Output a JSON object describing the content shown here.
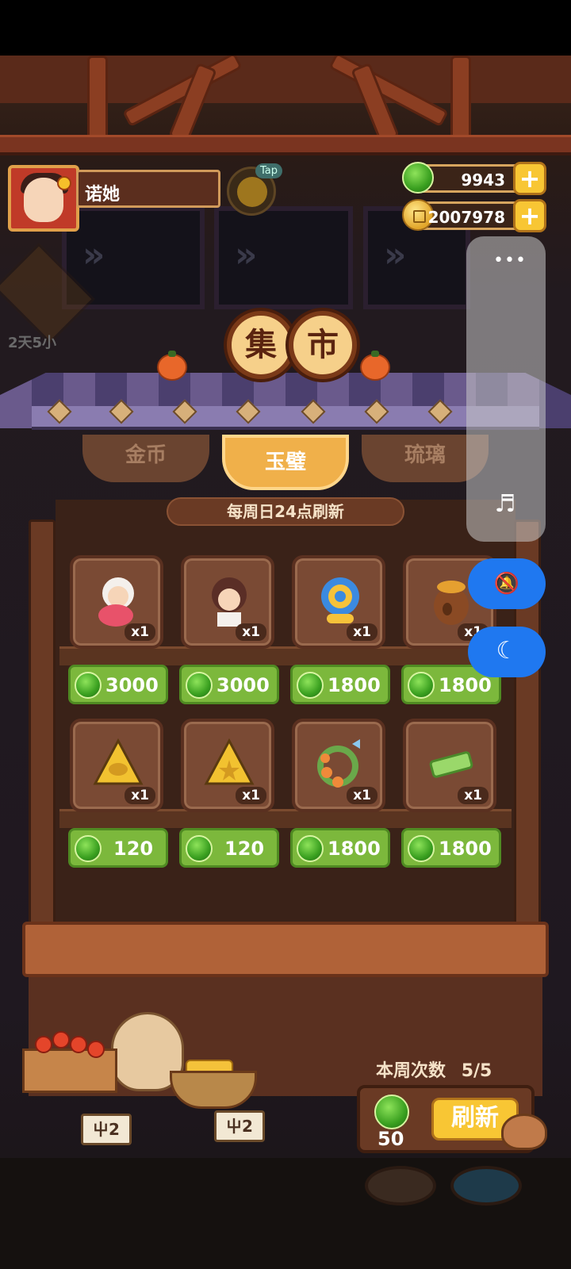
{
  "player": {
    "name": "诺她"
  },
  "tap_label": "Tap",
  "resources": {
    "jade": {
      "value": "9943",
      "icon": "jade-icon"
    },
    "coins": {
      "value": "2007978",
      "icon": "coin-icon"
    }
  },
  "event": {
    "countdown": "2天5小"
  },
  "sign_chars": [
    "集",
    "市"
  ],
  "tabs": [
    {
      "label": "金币",
      "active": false
    },
    {
      "label": "玉璧",
      "active": true
    },
    {
      "label": "琉璃",
      "active": false
    }
  ],
  "refresh_note": "每周日24点刷新",
  "items": [
    {
      "name": "chef-character-card",
      "qty": "x1",
      "price": "3000"
    },
    {
      "name": "maid-character-card",
      "qty": "x1",
      "price": "3000"
    },
    {
      "name": "blue-swirl-shell",
      "qty": "x1",
      "price": "1800"
    },
    {
      "name": "honey-pot",
      "qty": "x1",
      "price": "1800"
    },
    {
      "name": "fish-rice-ball",
      "qty": "x1",
      "price": "120"
    },
    {
      "name": "star-rice-ball",
      "qty": "x1",
      "price": "120"
    },
    {
      "name": "flower-butterfly-wreath",
      "qty": "x1",
      "price": "1800"
    },
    {
      "name": "green-jade-scroll",
      "qty": "x1",
      "price": "1800"
    }
  ],
  "weekly": {
    "label": "本周次数",
    "count": "5/5"
  },
  "refresh": {
    "cost": "50",
    "button_label": "刷新"
  },
  "tags": [
    "屮2",
    "屮2"
  ],
  "overlay": {
    "menu": "•••",
    "music_icon": "♬",
    "mute_icon": "🔕",
    "night_icon": "☾"
  },
  "colors": {
    "price_green": "#7cb83c",
    "active_tab": "#f0b04a",
    "accent_blue": "#1f78f0"
  }
}
